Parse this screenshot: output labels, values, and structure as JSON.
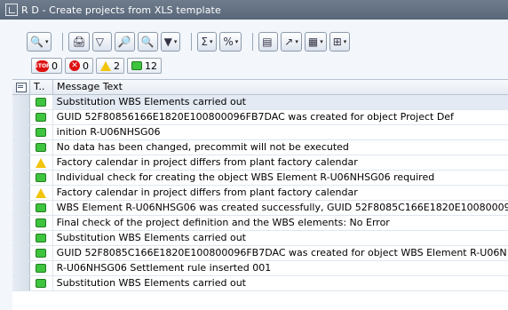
{
  "window": {
    "title": "R D - Create projects from XLS template"
  },
  "toolbar": {
    "buttons": [
      {
        "icon": "detail-icon"
      },
      {
        "icon": "print-icon"
      },
      {
        "icon": "filter-icon"
      },
      {
        "icon": "find-icon"
      },
      {
        "icon": "find-next-icon"
      },
      {
        "icon": "set-filter-icon"
      },
      {
        "icon": "sum-icon"
      },
      {
        "icon": "subtotal-icon"
      },
      {
        "icon": "print-preview-icon"
      },
      {
        "icon": "export-icon"
      },
      {
        "icon": "layout-icon"
      },
      {
        "icon": "grid-icon"
      }
    ]
  },
  "counters": {
    "stop": "0",
    "error": "0",
    "warning": "2",
    "success": "12"
  },
  "table": {
    "columns": {
      "type": "T..",
      "message": "Message Text"
    },
    "rows": [
      {
        "status": "success",
        "text": "Substitution WBS Elements carried out"
      },
      {
        "status": "success",
        "text": "GUID 52F80856166E1820E100800096FB7DAC was created for object Project Def"
      },
      {
        "status": "success",
        "text": "inition R-U06NHSG06"
      },
      {
        "status": "success",
        "text": "No data has been changed, precommit will not be executed"
      },
      {
        "status": "warning",
        "text": "Factory calendar in project differs from plant factory calendar"
      },
      {
        "status": "success",
        "text": "Individual check for creating the object WBS Element R-U06NHSG06 required"
      },
      {
        "status": "warning",
        "text": "Factory calendar in project differs from plant factory calendar"
      },
      {
        "status": "success",
        "text": "WBS Element R-U06NHSG06 was created successfully, GUID 52F8085C166E1820E10080009"
      },
      {
        "status": "success",
        "text": "Final check of the project definition and the WBS elements: No Error"
      },
      {
        "status": "success",
        "text": "Substitution WBS Elements carried out"
      },
      {
        "status": "success",
        "text": "GUID 52F8085C166E1820E100800096FB7DAC was created for object WBS Element R-U06N"
      },
      {
        "status": "success",
        "text": "R-U06NHSG06  Settlement rule inserted 001"
      },
      {
        "status": "success",
        "text": "Substitution WBS Elements carried out"
      }
    ]
  }
}
